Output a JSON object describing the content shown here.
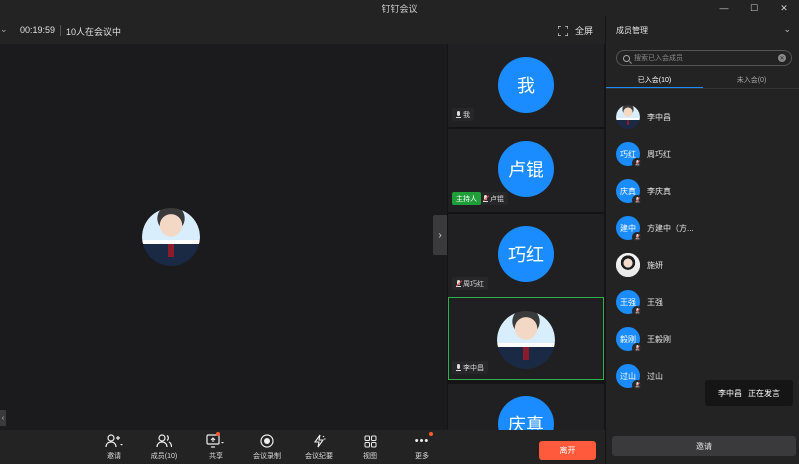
{
  "window": {
    "title": "钉钉会议",
    "minimize": "—",
    "maximize": "☐",
    "close": "✕"
  },
  "topbar": {
    "timer": "00:19:59",
    "count": "10人在会议中",
    "fullscreen": "全屏"
  },
  "thumbs": [
    {
      "label": "我",
      "tag": "我",
      "muted": false
    },
    {
      "label": "卢锟",
      "tag": "卢锟",
      "host": "主持人",
      "muted": true
    },
    {
      "label": "巧红",
      "tag": "周巧红",
      "muted": true
    },
    {
      "label": "",
      "tag": "李中昌",
      "muted": false,
      "photo": true
    },
    {
      "label": "庆真"
    }
  ],
  "toolbar": {
    "invite": "邀请",
    "members": "成员(10)",
    "share": "共享",
    "record": "会议录制",
    "minutes": "会议纪要",
    "view": "视图",
    "more": "更多",
    "leave": "离开"
  },
  "panel": {
    "title": "成员管理",
    "search_placeholder": "搜索已入会成员",
    "tab_joined": "已入会(10)",
    "tab_not_joined": "未入会(0)",
    "members": [
      {
        "name": "李中昌",
        "avatar": "",
        "photo": "man"
      },
      {
        "name": "周巧红",
        "avatar": "巧红"
      },
      {
        "name": "李庆真",
        "avatar": "庆真"
      },
      {
        "name": "方建中（方...",
        "avatar": "建中"
      },
      {
        "name": "施妍",
        "avatar": "",
        "photo": "woman"
      },
      {
        "name": "王强",
        "avatar": "王强"
      },
      {
        "name": "王毅刚",
        "avatar": "毅刚"
      },
      {
        "name": "过山",
        "avatar": "过山"
      }
    ],
    "invite_button": "邀请"
  },
  "toast": {
    "name": "李中昌",
    "status": "正在发言"
  }
}
